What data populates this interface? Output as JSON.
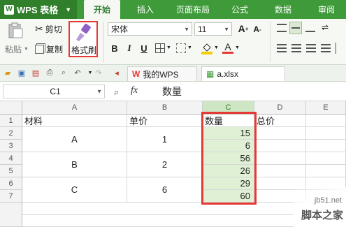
{
  "app": {
    "title": "WPS 表格"
  },
  "menu": {
    "tabs": [
      "开始",
      "插入",
      "页面布局",
      "公式",
      "数据",
      "审阅"
    ],
    "active": "开始"
  },
  "ribbon": {
    "paste_label": "粘贴",
    "cut_label": "剪切",
    "copy_label": "复制",
    "format_painter_label": "格式刷",
    "font_name": "宋体",
    "font_size": "11",
    "bold": "B",
    "italic": "I",
    "underline": "U",
    "grow_font": "A",
    "shrink_font": "A"
  },
  "docbar": {
    "tabs": [
      {
        "label": "我的WPS",
        "icon": "wps-icon"
      },
      {
        "label": "a.xlsx",
        "icon": "spreadsheet-icon"
      }
    ]
  },
  "formula": {
    "cell_ref": "C1",
    "fx": "fx",
    "value": "数量"
  },
  "sheet": {
    "columns": [
      "A",
      "B",
      "C",
      "D",
      "E"
    ],
    "rows": [
      "1",
      "2",
      "3",
      "4",
      "5",
      "6",
      "7"
    ],
    "cells": {
      "A1": "材料",
      "B1": "单价",
      "C1": "数量",
      "D1": "总价",
      "A3": "A",
      "A5": "B",
      "A7": "C",
      "B3": "1",
      "B5": "2",
      "B7": "6",
      "C2": "15",
      "C3": "6",
      "C4": "56",
      "C5": "26",
      "C6": "29",
      "C7": "60"
    },
    "selected_column": "C"
  },
  "watermark": {
    "line1": "jb51.net",
    "line2": "脚本之家"
  },
  "colors": {
    "brand": "#3f9b3a",
    "highlight_border": "#e53935",
    "selection_fill": "#dff0d4"
  }
}
